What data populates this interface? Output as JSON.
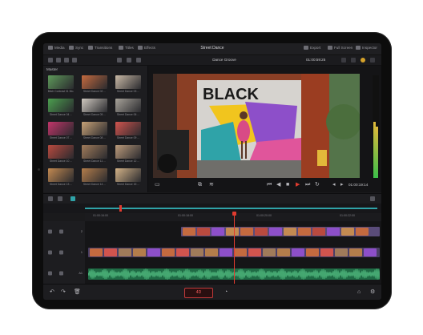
{
  "app": {
    "project_title": "Street Dance"
  },
  "topbar": {
    "left_tabs": [
      {
        "label": "Media",
        "icon": "media-icon"
      },
      {
        "label": "Sync",
        "icon": "sync-icon"
      },
      {
        "label": "Transitions",
        "icon": "transitions-icon"
      },
      {
        "label": "Titles",
        "icon": "titles-icon"
      },
      {
        "label": "Effects",
        "icon": "effects-icon"
      }
    ],
    "right_tabs": [
      {
        "label": "Export",
        "icon": "export-icon"
      },
      {
        "label": "Full Screen",
        "icon": "fullscreen-icon"
      },
      {
        "label": "Inspector",
        "icon": "inspector-icon"
      }
    ]
  },
  "viewer": {
    "clip_title": "Dance Groove",
    "timecode_top": "01:00:59:25",
    "timecode_bottom": "01:00:19:14",
    "overlay_text": "BLACK"
  },
  "media_pool": {
    "header": "Master",
    "clips": [
      {
        "label": "Bitch Contrast 01 Mo.",
        "color": "#5e9a5a"
      },
      {
        "label": "Street Dance 02 ...",
        "color": "#c46a3f"
      },
      {
        "label": "Street Dance 03 ...",
        "color": "#c9b9a6"
      },
      {
        "label": "Street Dance 04 ...",
        "color": "#4c9f4f"
      },
      {
        "label": "Street Dance 05 ...",
        "color": "#cfc8bf"
      },
      {
        "label": "Street Dance 06 ...",
        "color": "#a8a39a"
      },
      {
        "label": "Street Dance 07 ...",
        "color": "#c2356a"
      },
      {
        "label": "Street Dance 08 ...",
        "color": "#c7a277"
      },
      {
        "label": "Street Dance 09 ...",
        "color": "#d1544e"
      },
      {
        "label": "Street Dance 10 ...",
        "color": "#b94a3f"
      },
      {
        "label": "Street Dance 11 ...",
        "color": "#a07b5a"
      },
      {
        "label": "Street Dance 12 ...",
        "color": "#bb9b7b"
      },
      {
        "label": "Street Dance 13 ...",
        "color": "#c38a51"
      },
      {
        "label": "Street Dance 14 ...",
        "color": "#b37d4b"
      },
      {
        "label": "Street Dance 15 ...",
        "color": "#d3b287"
      }
    ]
  },
  "timeline": {
    "ruler_ticks": [
      "01:00:16:00",
      "01:00:18:00",
      "01:00:20:00",
      "01:00:22:00"
    ],
    "tracks": [
      {
        "name": "2",
        "type": "video"
      },
      {
        "name": "1",
        "type": "video"
      },
      {
        "name": "A1",
        "type": "audio"
      }
    ]
  },
  "bottombar": {
    "center_badge": "4D"
  },
  "colors": {
    "accent_red": "#e03b2f",
    "video_clip": "#6a5a8c",
    "audio_clip": "#2d8a5a",
    "teal": "#2fa3a8"
  }
}
